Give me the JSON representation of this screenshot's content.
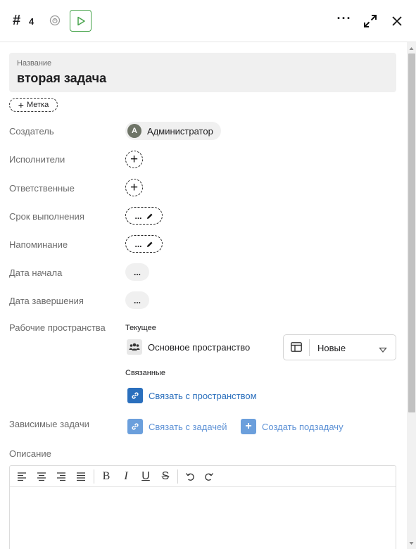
{
  "header": {
    "hash": "#",
    "task_number": "4",
    "more_label": "···"
  },
  "title": {
    "label": "Название",
    "value": "вторая задача"
  },
  "tag_button": {
    "plus": "+",
    "label": "Метка"
  },
  "fields": {
    "creator_label": "Создатель",
    "creator_initial": "A",
    "creator_name": "Администратор",
    "assignees_label": "Исполнители",
    "responsible_label": "Ответственные",
    "deadline_label": "Срок выполнения",
    "deadline_value": "...",
    "reminder_label": "Напоминание",
    "reminder_value": "...",
    "start_label": "Дата начала",
    "start_value": "...",
    "end_label": "Дата завершения",
    "end_value": "...",
    "plus": "+"
  },
  "workspaces": {
    "label": "Рабочие пространства",
    "current_heading": "Текущее",
    "current_name": "Основное пространство",
    "status": "Новые",
    "related_heading": "Связанные",
    "link_workspace": "Связать с пространством"
  },
  "dependencies": {
    "label": "Зависимые задачи",
    "link_task": "Связать с задачей",
    "create_subtask": "Создать подзадачу",
    "plus": "+"
  },
  "description": {
    "label": "Описание",
    "toolbar": {
      "bold": "B",
      "italic": "I",
      "underline": "U",
      "strike": "S"
    }
  },
  "colors": {
    "accent_green": "#46a34a",
    "link_blue": "#2a6fbd",
    "link_blue_light": "#6b9fdc",
    "field_bg": "#f0f0f0"
  }
}
